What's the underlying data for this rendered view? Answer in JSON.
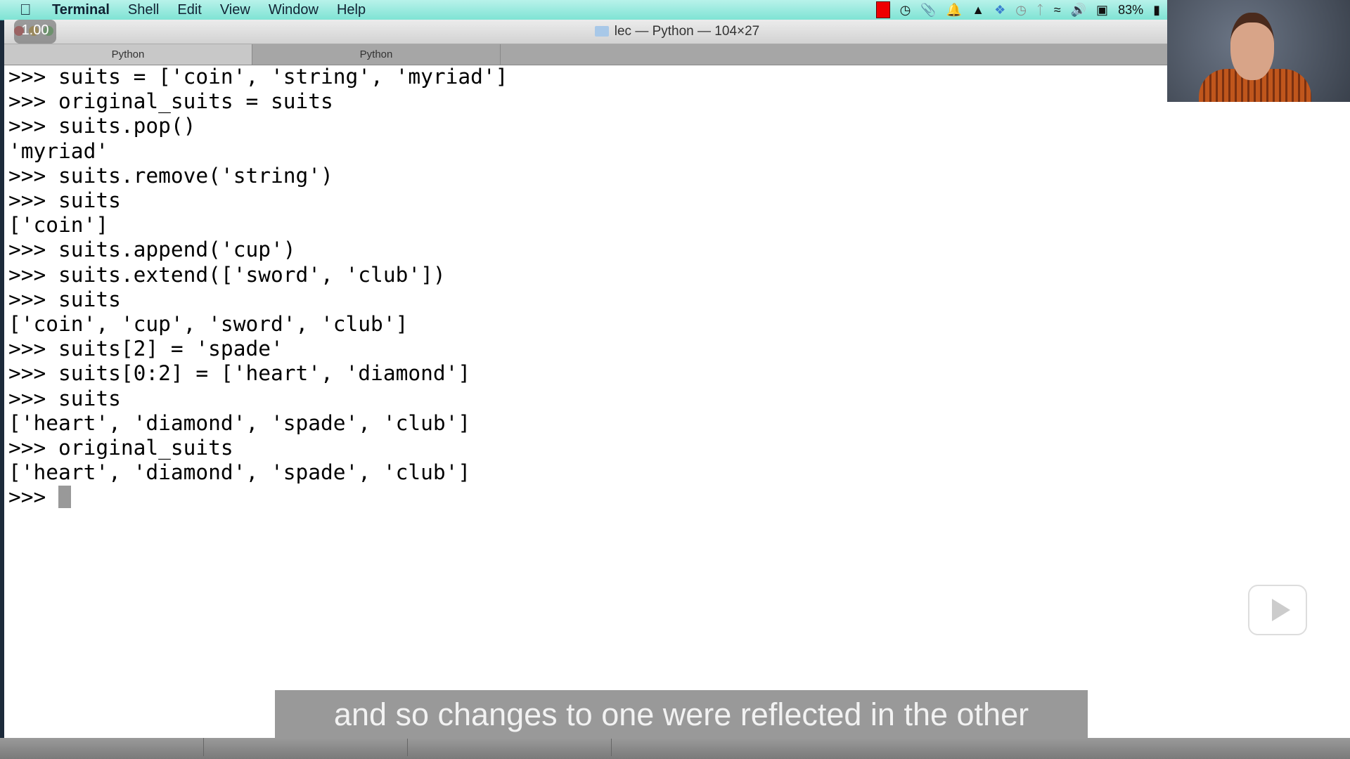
{
  "menubar": {
    "app": "Terminal",
    "items": [
      "Shell",
      "Edit",
      "View",
      "Window",
      "Help"
    ],
    "battery": "83%",
    "tray_icons": [
      "recording-icon",
      "clock-app-icon",
      "paperclip-icon",
      "bell-icon",
      "google-drive-icon",
      "dropbox-icon",
      "time-machine-icon",
      "bluetooth-icon",
      "wifi-icon",
      "volume-icon",
      "input-menu-icon",
      "battery-icon"
    ]
  },
  "window": {
    "title": "lec — Python — 104×27",
    "speed_badge": "1.00",
    "tabs": [
      "Python",
      "Python"
    ]
  },
  "terminal": {
    "lines": [
      ">>> suits = ['coin', 'string', 'myriad']",
      ">>> original_suits = suits",
      ">>> suits.pop()",
      "'myriad'",
      ">>> suits.remove('string')",
      ">>> suits",
      "['coin']",
      ">>> suits.append('cup')",
      ">>> suits.extend(['sword', 'club'])",
      ">>> suits",
      "['coin', 'cup', 'sword', 'club']",
      ">>> suits[2] = 'spade'",
      ">>> suits[0:2] = ['heart', 'diamond']",
      ">>> suits",
      "['heart', 'diamond', 'spade', 'club']",
      ">>> original_suits",
      "['heart', 'diamond', 'spade', 'club']"
    ],
    "prompt": ">>> "
  },
  "caption": "and so changes to one were reflected in the other",
  "colors": {
    "menubar": "#7fe3d4",
    "caption_bg": "#999999"
  }
}
